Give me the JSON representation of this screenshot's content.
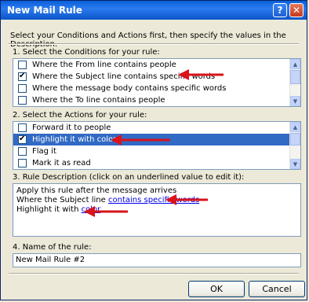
{
  "window": {
    "title": "New Mail Rule",
    "help_glyph": "?",
    "close_glyph": "✕"
  },
  "instruction": "Select your Conditions and Actions first, then specify the values in the Description.",
  "conditions": {
    "label": "1. Select the Conditions for your rule:",
    "items": [
      {
        "label": "Where the From line contains people",
        "checked": false
      },
      {
        "label": "Where the Subject line contains specific words",
        "checked": true
      },
      {
        "label": "Where the message body contains specific words",
        "checked": false
      },
      {
        "label": "Where the To line contains people",
        "checked": false
      }
    ]
  },
  "actions": {
    "label": "2. Select the Actions for your rule:",
    "items": [
      {
        "label": "Forward it to people",
        "checked": false
      },
      {
        "label": "Highlight it with color",
        "checked": true,
        "selected": true
      },
      {
        "label": "Flag it",
        "checked": false
      },
      {
        "label": "Mark it as read",
        "checked": false
      }
    ]
  },
  "description": {
    "label": "3. Rule Description (click on an underlined value to edit it):",
    "line1": "Apply this rule after the message arrives",
    "line2_prefix": "Where the Subject line ",
    "line2_link": "contains specific words",
    "line3_prefix": "Highlight it with ",
    "line3_link": "color"
  },
  "name": {
    "label": "4. Name of the rule:",
    "value": "New Mail Rule #2"
  },
  "buttons": {
    "ok": "OK",
    "cancel": "Cancel"
  },
  "annotation_color": "#D9141B",
  "icons": {
    "checkmark": "✔",
    "scroll_up": "▲",
    "scroll_down": "▼"
  }
}
